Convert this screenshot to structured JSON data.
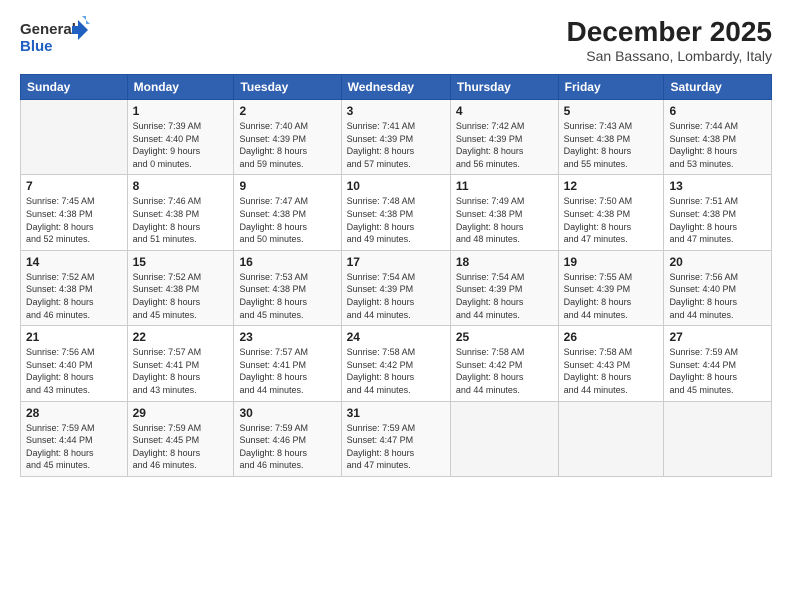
{
  "logo": {
    "line1": "General",
    "line2": "Blue"
  },
  "title": "December 2025",
  "subtitle": "San Bassano, Lombardy, Italy",
  "headers": [
    "Sunday",
    "Monday",
    "Tuesday",
    "Wednesday",
    "Thursday",
    "Friday",
    "Saturday"
  ],
  "weeks": [
    [
      {
        "day": "",
        "info": ""
      },
      {
        "day": "1",
        "info": "Sunrise: 7:39 AM\nSunset: 4:40 PM\nDaylight: 9 hours\nand 0 minutes."
      },
      {
        "day": "2",
        "info": "Sunrise: 7:40 AM\nSunset: 4:39 PM\nDaylight: 8 hours\nand 59 minutes."
      },
      {
        "day": "3",
        "info": "Sunrise: 7:41 AM\nSunset: 4:39 PM\nDaylight: 8 hours\nand 57 minutes."
      },
      {
        "day": "4",
        "info": "Sunrise: 7:42 AM\nSunset: 4:39 PM\nDaylight: 8 hours\nand 56 minutes."
      },
      {
        "day": "5",
        "info": "Sunrise: 7:43 AM\nSunset: 4:38 PM\nDaylight: 8 hours\nand 55 minutes."
      },
      {
        "day": "6",
        "info": "Sunrise: 7:44 AM\nSunset: 4:38 PM\nDaylight: 8 hours\nand 53 minutes."
      }
    ],
    [
      {
        "day": "7",
        "info": "Sunrise: 7:45 AM\nSunset: 4:38 PM\nDaylight: 8 hours\nand 52 minutes."
      },
      {
        "day": "8",
        "info": "Sunrise: 7:46 AM\nSunset: 4:38 PM\nDaylight: 8 hours\nand 51 minutes."
      },
      {
        "day": "9",
        "info": "Sunrise: 7:47 AM\nSunset: 4:38 PM\nDaylight: 8 hours\nand 50 minutes."
      },
      {
        "day": "10",
        "info": "Sunrise: 7:48 AM\nSunset: 4:38 PM\nDaylight: 8 hours\nand 49 minutes."
      },
      {
        "day": "11",
        "info": "Sunrise: 7:49 AM\nSunset: 4:38 PM\nDaylight: 8 hours\nand 48 minutes."
      },
      {
        "day": "12",
        "info": "Sunrise: 7:50 AM\nSunset: 4:38 PM\nDaylight: 8 hours\nand 47 minutes."
      },
      {
        "day": "13",
        "info": "Sunrise: 7:51 AM\nSunset: 4:38 PM\nDaylight: 8 hours\nand 47 minutes."
      }
    ],
    [
      {
        "day": "14",
        "info": "Sunrise: 7:52 AM\nSunset: 4:38 PM\nDaylight: 8 hours\nand 46 minutes."
      },
      {
        "day": "15",
        "info": "Sunrise: 7:52 AM\nSunset: 4:38 PM\nDaylight: 8 hours\nand 45 minutes."
      },
      {
        "day": "16",
        "info": "Sunrise: 7:53 AM\nSunset: 4:38 PM\nDaylight: 8 hours\nand 45 minutes."
      },
      {
        "day": "17",
        "info": "Sunrise: 7:54 AM\nSunset: 4:39 PM\nDaylight: 8 hours\nand 44 minutes."
      },
      {
        "day": "18",
        "info": "Sunrise: 7:54 AM\nSunset: 4:39 PM\nDaylight: 8 hours\nand 44 minutes."
      },
      {
        "day": "19",
        "info": "Sunrise: 7:55 AM\nSunset: 4:39 PM\nDaylight: 8 hours\nand 44 minutes."
      },
      {
        "day": "20",
        "info": "Sunrise: 7:56 AM\nSunset: 4:40 PM\nDaylight: 8 hours\nand 44 minutes."
      }
    ],
    [
      {
        "day": "21",
        "info": "Sunrise: 7:56 AM\nSunset: 4:40 PM\nDaylight: 8 hours\nand 43 minutes."
      },
      {
        "day": "22",
        "info": "Sunrise: 7:57 AM\nSunset: 4:41 PM\nDaylight: 8 hours\nand 43 minutes."
      },
      {
        "day": "23",
        "info": "Sunrise: 7:57 AM\nSunset: 4:41 PM\nDaylight: 8 hours\nand 44 minutes."
      },
      {
        "day": "24",
        "info": "Sunrise: 7:58 AM\nSunset: 4:42 PM\nDaylight: 8 hours\nand 44 minutes."
      },
      {
        "day": "25",
        "info": "Sunrise: 7:58 AM\nSunset: 4:42 PM\nDaylight: 8 hours\nand 44 minutes."
      },
      {
        "day": "26",
        "info": "Sunrise: 7:58 AM\nSunset: 4:43 PM\nDaylight: 8 hours\nand 44 minutes."
      },
      {
        "day": "27",
        "info": "Sunrise: 7:59 AM\nSunset: 4:44 PM\nDaylight: 8 hours\nand 45 minutes."
      }
    ],
    [
      {
        "day": "28",
        "info": "Sunrise: 7:59 AM\nSunset: 4:44 PM\nDaylight: 8 hours\nand 45 minutes."
      },
      {
        "day": "29",
        "info": "Sunrise: 7:59 AM\nSunset: 4:45 PM\nDaylight: 8 hours\nand 46 minutes."
      },
      {
        "day": "30",
        "info": "Sunrise: 7:59 AM\nSunset: 4:46 PM\nDaylight: 8 hours\nand 46 minutes."
      },
      {
        "day": "31",
        "info": "Sunrise: 7:59 AM\nSunset: 4:47 PM\nDaylight: 8 hours\nand 47 minutes."
      },
      {
        "day": "",
        "info": ""
      },
      {
        "day": "",
        "info": ""
      },
      {
        "day": "",
        "info": ""
      }
    ]
  ]
}
